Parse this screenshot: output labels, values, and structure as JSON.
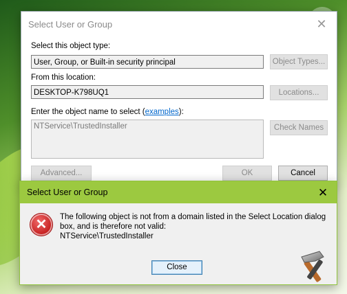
{
  "main_dialog": {
    "title": "Select User or Group",
    "object_type_label": "Select this object type:",
    "object_type_value": "User, Group, or Built-in security principal",
    "object_types_button": "Object Types...",
    "location_label": "From this location:",
    "location_value": "DESKTOP-K798UQ1",
    "locations_button": "Locations...",
    "enter_name_prefix": "Enter the object name to select (",
    "examples_link": "examples",
    "enter_name_suffix": "):",
    "object_name_value": "NTService\\TrustedInstaller",
    "check_names_button": "Check Names",
    "advanced_button": "Advanced...",
    "ok_button": "OK",
    "cancel_button": "Cancel"
  },
  "error_dialog": {
    "title": "Select User or Group",
    "message": "The following object is not from a domain listed in the Select Location dialog box, and is therefore not valid:",
    "object": "NTService\\TrustedInstaller",
    "close_button": "Close"
  },
  "icons": {
    "close": "close-icon",
    "error": "error-icon",
    "watermark": "tools-hammer-logo"
  },
  "colors": {
    "error_titlebar": "#9cc940",
    "link": "#0066cc",
    "error_icon": "#c41d1d"
  }
}
